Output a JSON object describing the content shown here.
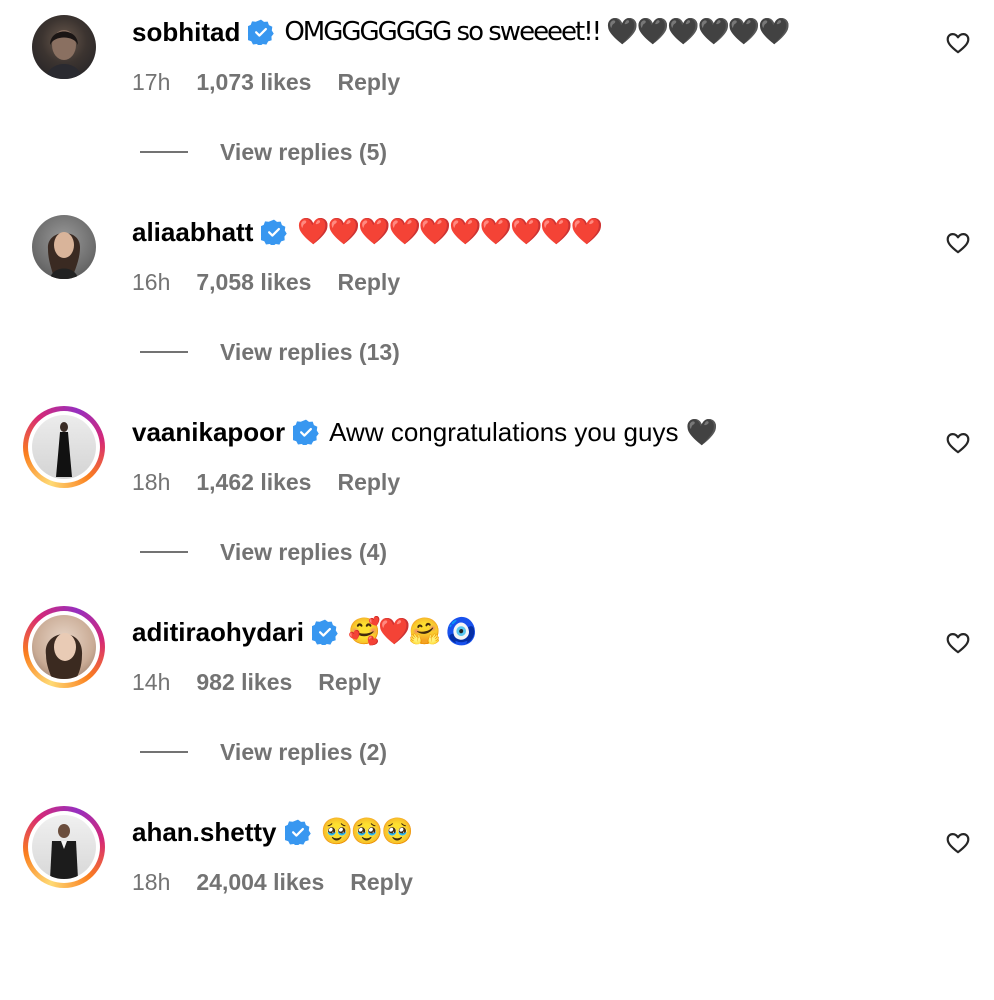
{
  "comments": [
    {
      "username": "sobhitad",
      "text": "OMGGGGGGG so sweeeet!! 🖤🖤🖤🖤🖤🖤",
      "time": "17h",
      "likes": "1,073 likes",
      "reply": "Reply",
      "view_replies": "View replies (5)",
      "story_ring": false
    },
    {
      "username": "aliaabhatt",
      "text": "❤️❤️❤️❤️❤️❤️❤️❤️❤️❤️",
      "time": "16h",
      "likes": "7,058 likes",
      "reply": "Reply",
      "view_replies": "View replies (13)",
      "story_ring": false
    },
    {
      "username": "vaanikapoor",
      "text": "Aww congratulations you guys 🖤",
      "time": "18h",
      "likes": "1,462 likes",
      "reply": "Reply",
      "view_replies": "View replies (4)",
      "story_ring": true
    },
    {
      "username": "aditiraohydari",
      "text": "🥰❤️🤗 🧿",
      "time": "14h",
      "likes": "982 likes",
      "reply": "Reply",
      "view_replies": "View replies (2)",
      "story_ring": true
    },
    {
      "username": "ahan.shetty",
      "text": "🥹🥹🥹",
      "time": "18h",
      "likes": "24,004 likes",
      "reply": "Reply",
      "story_ring": true
    }
  ],
  "colors": {
    "verified": "#3897f0",
    "meta": "#737373",
    "text": "#000000"
  }
}
